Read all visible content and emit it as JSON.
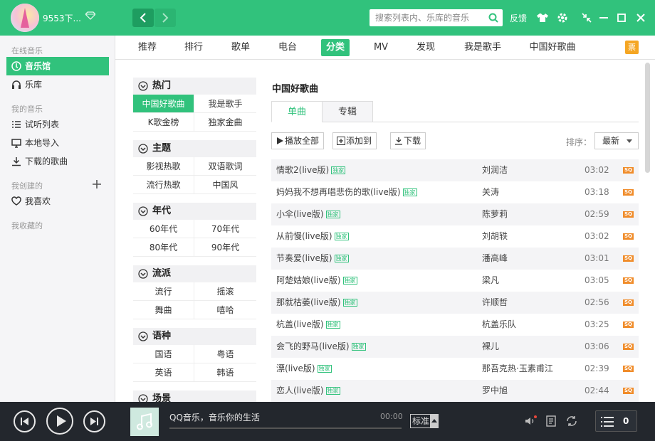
{
  "header": {
    "username": "9553下...",
    "search_placeholder": "搜索列表内、乐库的音乐",
    "feedback": "反馈"
  },
  "sidebar": {
    "sections": [
      {
        "heading": "在线音乐",
        "items": [
          {
            "label": "音乐馆",
            "icon": "disc-icon",
            "active": true
          },
          {
            "label": "乐库",
            "icon": "headphones-icon"
          }
        ]
      },
      {
        "heading": "我的音乐",
        "items": [
          {
            "label": "试听列表",
            "icon": "list-icon"
          },
          {
            "label": "本地导入",
            "icon": "monitor-icon"
          },
          {
            "label": "下载的歌曲",
            "icon": "download-icon"
          }
        ]
      },
      {
        "heading": "我创建的",
        "items": [
          {
            "label": "我喜欢",
            "icon": "heart-icon"
          }
        ]
      },
      {
        "heading": "我收藏的",
        "items": []
      }
    ]
  },
  "subnav": {
    "tabs": [
      "推荐",
      "排行",
      "歌单",
      "电台",
      "分类",
      "MV",
      "发现",
      "我是歌手",
      "中国好歌曲"
    ],
    "active": "分类",
    "ticket": "票"
  },
  "categories": [
    {
      "title": "热门",
      "items": [
        "中国好歌曲",
        "我是歌手",
        "K歌金榜",
        "独家金曲"
      ],
      "active": "中国好歌曲"
    },
    {
      "title": "主题",
      "items": [
        "影视热歌",
        "双语歌词",
        "流行热歌",
        "中国风"
      ]
    },
    {
      "title": "年代",
      "items": [
        "60年代",
        "70年代",
        "80年代",
        "90年代"
      ]
    },
    {
      "title": "流派",
      "items": [
        "流行",
        "摇滚",
        "舞曲",
        "嘻哈"
      ]
    },
    {
      "title": "语种",
      "items": [
        "国语",
        "粤语",
        "英语",
        "韩语"
      ]
    },
    {
      "title": "场景",
      "items": []
    }
  ],
  "content": {
    "title": "中国好歌曲",
    "tabs": [
      "单曲",
      "专辑"
    ],
    "active_tab": "单曲",
    "toolbar": {
      "play_all": "播放全部",
      "add_to": "添加到",
      "download": "下载"
    },
    "sort_label": "排序：",
    "sort_value": "最新",
    "badge_text": "独家",
    "sq_text": "SQ",
    "songs": [
      {
        "name": "情歌2(live版)",
        "artist": "刘润洁",
        "duration": "03:02"
      },
      {
        "name": "妈妈我不想再唱悲伤的歌(live版)",
        "artist": "关涛",
        "duration": "03:18"
      },
      {
        "name": "小伞(live版)",
        "artist": "陈萝莉",
        "duration": "02:59"
      },
      {
        "name": "从前慢(live版)",
        "artist": "刘胡轶",
        "duration": "03:02"
      },
      {
        "name": "节奏爱(live版)",
        "artist": "潘高峰",
        "duration": "03:01"
      },
      {
        "name": "阿楚姑娘(live版)",
        "artist": "梁凡",
        "duration": "03:05"
      },
      {
        "name": "那就枯萎(live版)",
        "artist": "许顺哲",
        "duration": "02:56"
      },
      {
        "name": "杭盖(live版)",
        "artist": "杭盖乐队",
        "duration": "03:25"
      },
      {
        "name": "会飞的野马(live版)",
        "artist": "裸儿",
        "duration": "03:06"
      },
      {
        "name": "漂(live版)",
        "artist": "那吾克热·玉素甫江",
        "duration": "02:39"
      },
      {
        "name": "恋人(live版)",
        "artist": "罗中旭",
        "duration": "02:44"
      }
    ]
  },
  "player": {
    "title": "QQ音乐，音乐你的生活",
    "time": "00:00",
    "progress": 0,
    "quality": "标准",
    "playlist_count": "0"
  },
  "colors": {
    "accent": "#31c27c",
    "player_bg": "#23272d",
    "sq": "#f08c2a"
  }
}
